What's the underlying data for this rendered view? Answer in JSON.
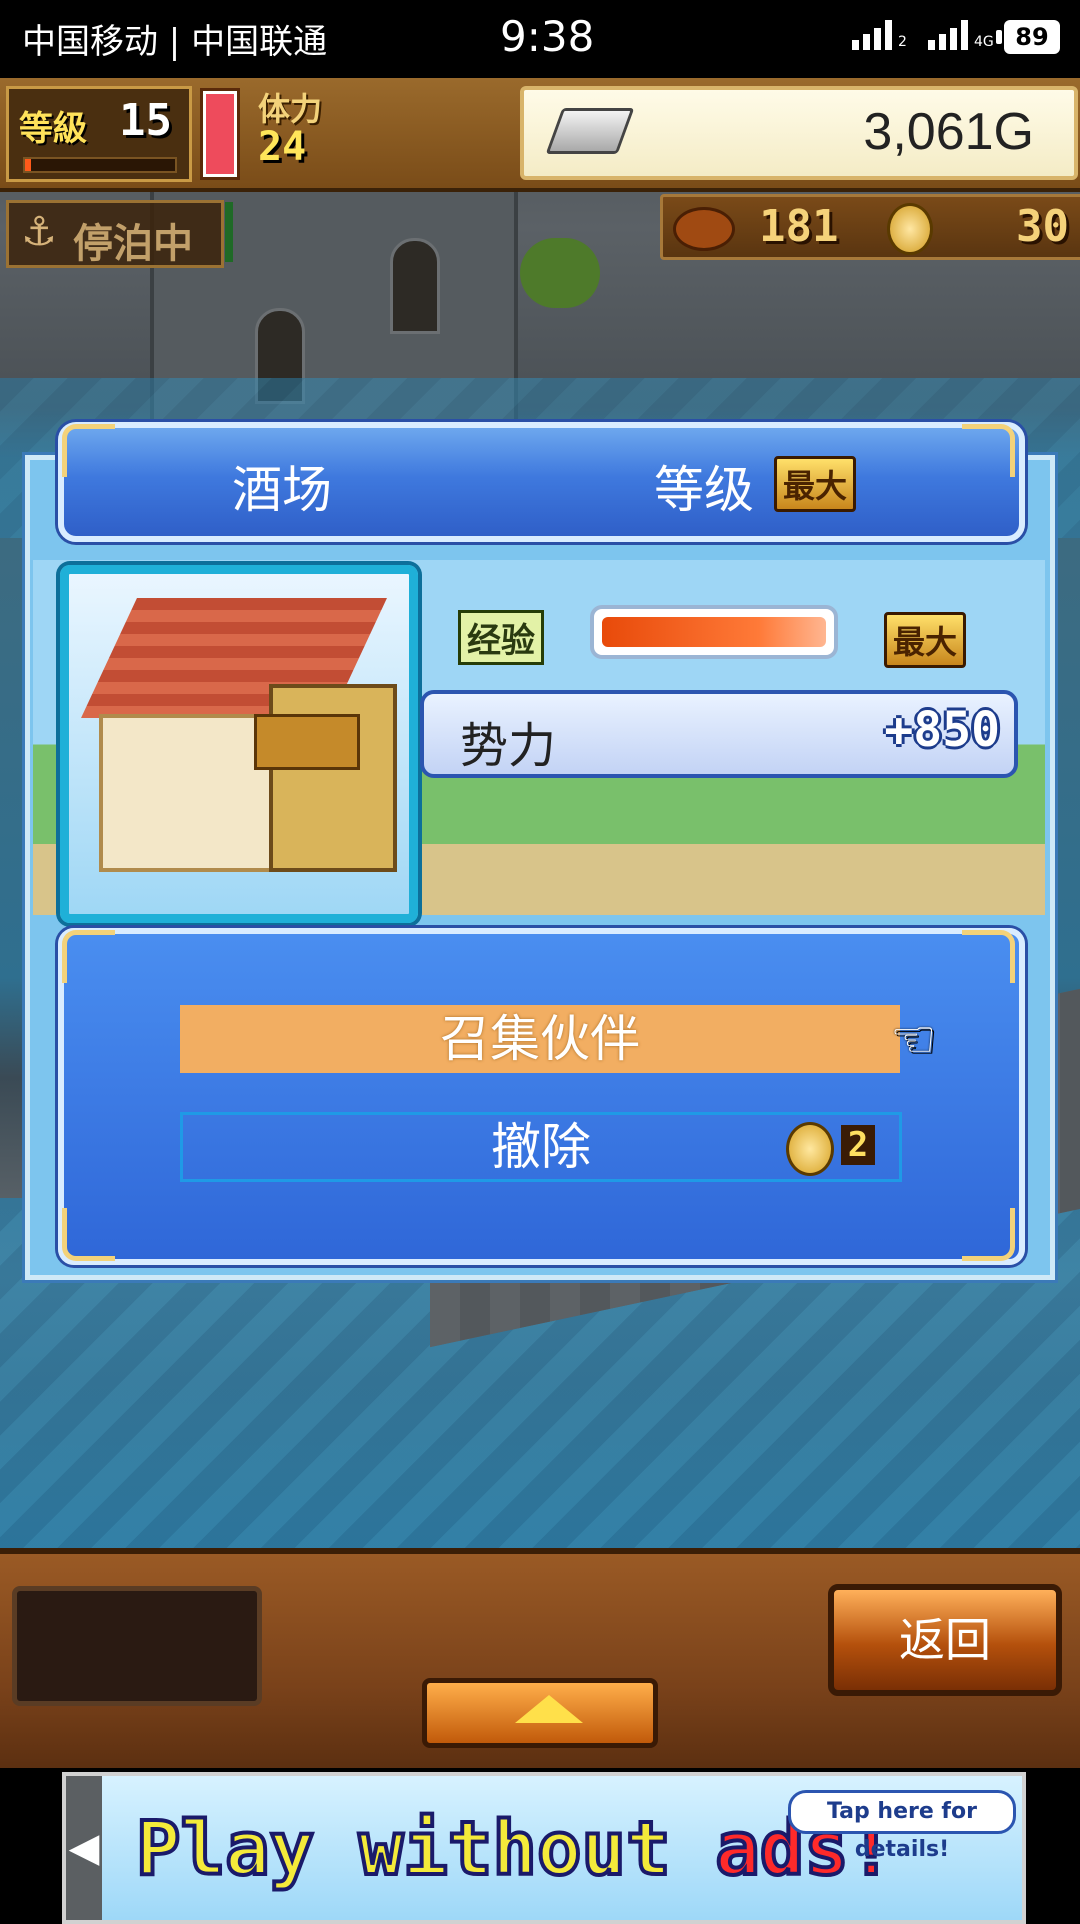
{
  "status_bar": {
    "carrier": "中国移动 | 中国联通",
    "time": "9:38",
    "signal_sim2_badge": "2",
    "signal_sim1_badge": "4G",
    "battery": "89"
  },
  "hud": {
    "level_label": "等級",
    "level_value": "15",
    "level_progress": 0.04,
    "stamina_label": "体力",
    "stamina_value": "24",
    "gold": "3,061G",
    "dock_status": "停泊中",
    "food_count": "181",
    "coin_count": "30"
  },
  "dialog": {
    "building_name": "酒场",
    "level_label": "等级",
    "level_value": "最大",
    "exp_label": "经验",
    "exp_progress": 1.0,
    "exp_value": "最大",
    "power_label": "势力",
    "power_value": "+850",
    "menu": {
      "recruit_label": "召集伙伴",
      "remove_label": "撤除",
      "remove_cost": "2"
    }
  },
  "bottom_bar": {
    "back_label": "返回"
  },
  "ad_banner": {
    "text_main": "Play without",
    "text_accent": "ads!",
    "tip": "Tap here for details!"
  },
  "colors": {
    "dialog_blue": "#2f67d8",
    "highlight_orange": "#f2ae62",
    "wood": "#7a421a"
  }
}
